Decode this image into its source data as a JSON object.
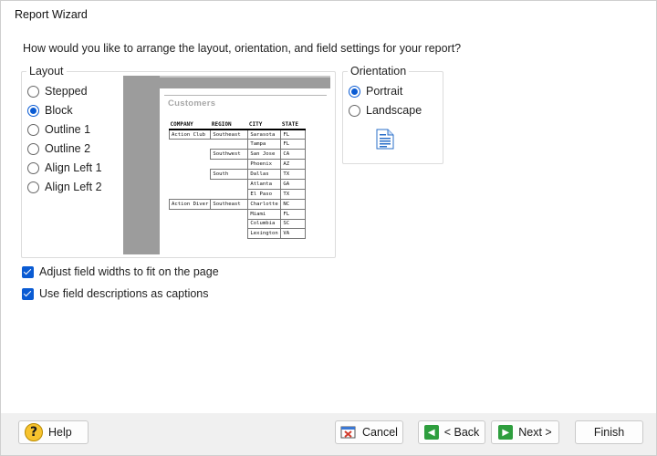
{
  "window": {
    "title": "Report Wizard"
  },
  "prompt": "How would you like to arrange the layout, orientation, and field settings for your report?",
  "layout": {
    "legend": "Layout",
    "options": [
      {
        "label": "Stepped",
        "checked": false
      },
      {
        "label": "Block",
        "checked": true
      },
      {
        "label": "Outline 1",
        "checked": false
      },
      {
        "label": "Outline 2",
        "checked": false
      },
      {
        "label": "Align Left 1",
        "checked": false
      },
      {
        "label": "Align Left 2",
        "checked": false
      }
    ]
  },
  "preview": {
    "title": "Customers",
    "headers": [
      "COMPANY",
      "REGION",
      "CITY",
      "STATE"
    ],
    "rows": [
      [
        "Action Club",
        "Southeast",
        "Sarasota",
        "FL"
      ],
      [
        "",
        "",
        "Tampa",
        "FL"
      ],
      [
        "",
        "Southwest",
        "San Jose",
        "CA"
      ],
      [
        "",
        "",
        "Phoenix",
        "AZ"
      ],
      [
        "",
        "South",
        "Dallas",
        "TX"
      ],
      [
        "",
        "",
        "Atlanta",
        "GA"
      ],
      [
        "",
        "",
        "El Paso",
        "TX"
      ],
      [
        "Action Diver",
        "Southeast",
        "Charlotte",
        "NC"
      ],
      [
        "",
        "",
        "Miami",
        "FL"
      ],
      [
        "",
        "",
        "Columbia",
        "SC"
      ],
      [
        "",
        "",
        "Lexington",
        "VA"
      ]
    ]
  },
  "orientation": {
    "legend": "Orientation",
    "options": [
      {
        "label": "Portrait",
        "checked": true
      },
      {
        "label": "Landscape",
        "checked": false
      }
    ],
    "icon": "portrait-page-icon"
  },
  "options": {
    "adjust_widths": {
      "label": "Adjust field widths to fit on the page",
      "checked": true
    },
    "use_descriptions": {
      "label": "Use field descriptions as captions",
      "checked": true
    }
  },
  "buttons": {
    "help": "Help",
    "cancel": "Cancel",
    "back": "< Back",
    "next": "Next >",
    "finish": "Finish"
  },
  "colors": {
    "accent": "#0a5bd3",
    "footer": "#f0f0f0",
    "preview_bg": "#9c9c9c"
  }
}
